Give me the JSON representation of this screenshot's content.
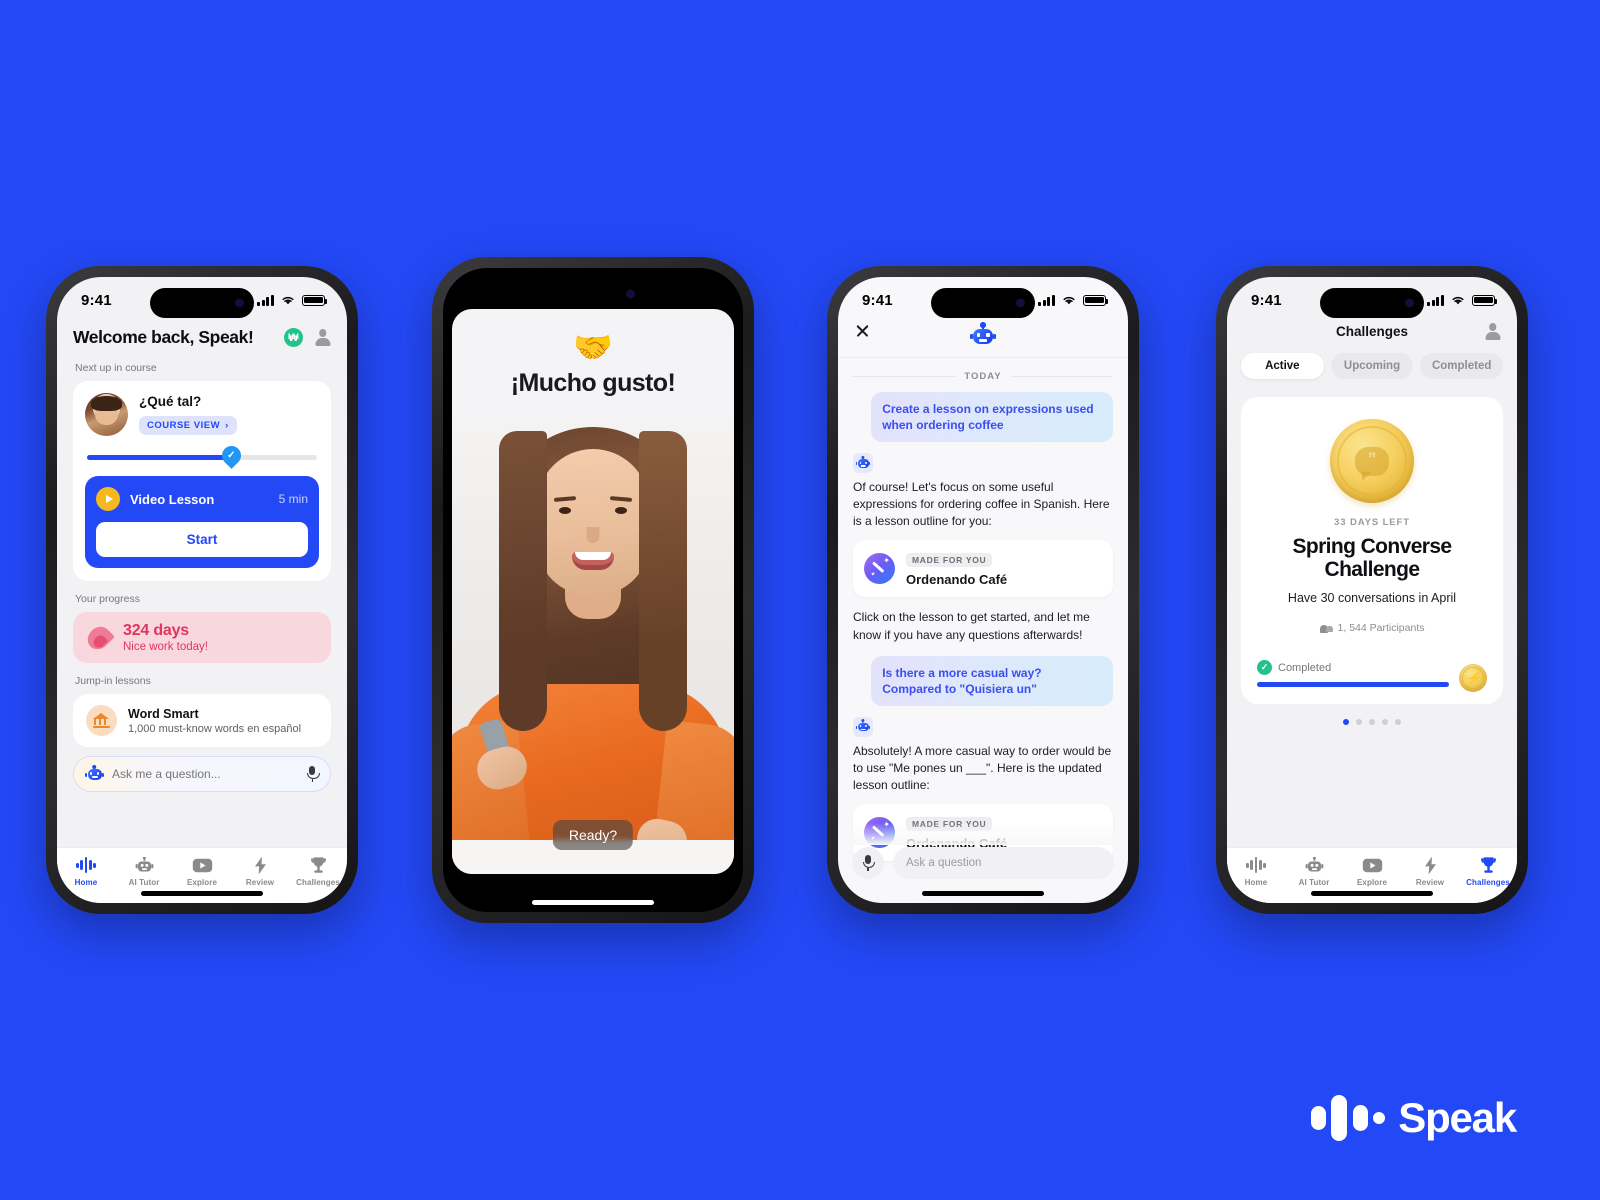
{
  "brand": {
    "name": "Speak",
    "logo_icon": "speak-waveform-logo",
    "background_color": "#2348f5"
  },
  "phone1": {
    "status": {
      "time": "9:41",
      "signal_icon": "cellular-bars-icon",
      "wifi_icon": "wifi-icon",
      "battery_icon": "battery-full-icon"
    },
    "header": {
      "title": "Welcome back, Speak!",
      "currency_badge": "₩",
      "profile_icon": "person-icon"
    },
    "next_up": {
      "section_label": "Next up in course",
      "course_name": "¿Qué tal?",
      "course_view_label": "COURSE VIEW",
      "course_view_chevron": "›",
      "avatar_icon": "tutor-avatar",
      "progress_percent": 62,
      "lesson": {
        "play_icon": "play-icon",
        "name": "Video Lesson",
        "duration": "5 min",
        "start_label": "Start"
      }
    },
    "progress": {
      "section_label": "Your progress",
      "flame_icon": "flame-icon",
      "streak_days": "324 days",
      "streak_note": "Nice work today!"
    },
    "jump_in": {
      "section_label": "Jump-in lessons",
      "icon": "bank-building-icon",
      "title": "Word Smart",
      "subtitle": "1,000 must-know words en español"
    },
    "ask_bar": {
      "bot_icon": "robot-icon",
      "placeholder": "Ask me a question...",
      "mic_icon": "microphone-icon"
    },
    "nav": [
      {
        "label": "Home",
        "icon": "waveform-icon",
        "active": true
      },
      {
        "label": "AI Tutor",
        "icon": "robot-icon",
        "active": false
      },
      {
        "label": "Explore",
        "icon": "video-play-icon",
        "active": false
      },
      {
        "label": "Review",
        "icon": "lightning-bolt-icon",
        "active": false
      },
      {
        "label": "Challenges",
        "icon": "trophy-icon",
        "active": false
      }
    ]
  },
  "phone2": {
    "hands_emoji": "🤝",
    "title": "¡Mucho gusto!",
    "ready_label": "Ready?"
  },
  "phone3": {
    "status": {
      "time": "9:41"
    },
    "header": {
      "close_icon": "close-x-icon",
      "bot_icon": "robot-icon"
    },
    "day_divider": "TODAY",
    "messages": [
      {
        "role": "user",
        "text": "Create a lesson on expressions used when ordering coffee"
      },
      {
        "role": "ai",
        "text": "Of course! Let's focus on some useful expressions for ordering coffee in Spanish. Here is a lesson outline for you:"
      },
      {
        "role": "lesson_card",
        "badge": "MADE FOR YOU",
        "title": "Ordenando Café",
        "icon": "magic-wand-icon"
      },
      {
        "role": "ai",
        "text": "Click on the lesson to get started, and let me know if you have any questions afterwards!"
      },
      {
        "role": "user",
        "text": "Is there a more casual way? Compared to \"Quisiera un\""
      },
      {
        "role": "ai",
        "text": "Absolutely! A more casual way to order would be to use \"Me pones un ___\". Here is the updated lesson outline:"
      },
      {
        "role": "lesson_card",
        "badge": "MADE FOR YOU",
        "title": "Ordenando Café",
        "icon": "magic-wand-icon"
      }
    ],
    "input": {
      "mic_icon": "microphone-icon",
      "placeholder": "Ask a question"
    }
  },
  "phone4": {
    "status": {
      "time": "9:41"
    },
    "header": {
      "title": "Challenges",
      "profile_icon": "person-icon"
    },
    "tabs": [
      {
        "label": "Active",
        "active": true
      },
      {
        "label": "Upcoming",
        "active": false
      },
      {
        "label": "Completed",
        "active": false
      }
    ],
    "challenge": {
      "badge_icon": "speech-bubble-coin-icon",
      "days_left": "33 DAYS LEFT",
      "title": "Spring Converse Challenge",
      "description": "Have 30 conversations in April",
      "participants_icon": "people-icon",
      "participants": "1, 544 Participants",
      "progress_label": "Completed",
      "progress_check_icon": "check-circle-icon",
      "progress_percent": 100,
      "reward_icon": "lightning-coin-icon"
    },
    "pagination": {
      "total": 5,
      "active_index": 0
    },
    "nav": [
      {
        "label": "Home",
        "icon": "waveform-icon",
        "active": false
      },
      {
        "label": "AI Tutor",
        "icon": "robot-icon",
        "active": false
      },
      {
        "label": "Explore",
        "icon": "video-play-icon",
        "active": false
      },
      {
        "label": "Review",
        "icon": "lightning-bolt-icon",
        "active": false
      },
      {
        "label": "Challenges",
        "icon": "trophy-icon",
        "active": true
      }
    ]
  }
}
